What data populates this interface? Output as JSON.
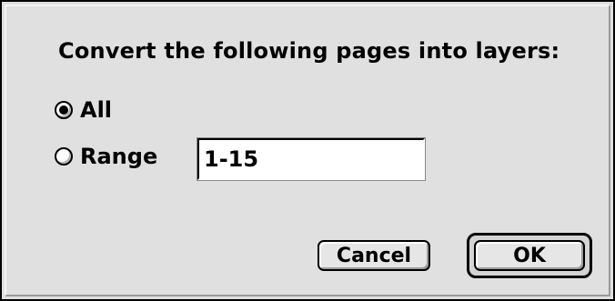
{
  "dialog": {
    "prompt": "Convert the following pages into layers:",
    "options": [
      {
        "label": "All",
        "selected": true
      },
      {
        "label": "Range",
        "selected": false
      }
    ],
    "range_value": "1-15",
    "buttons": {
      "cancel_label": "Cancel",
      "ok_label": "OK",
      "default": "OK"
    }
  }
}
